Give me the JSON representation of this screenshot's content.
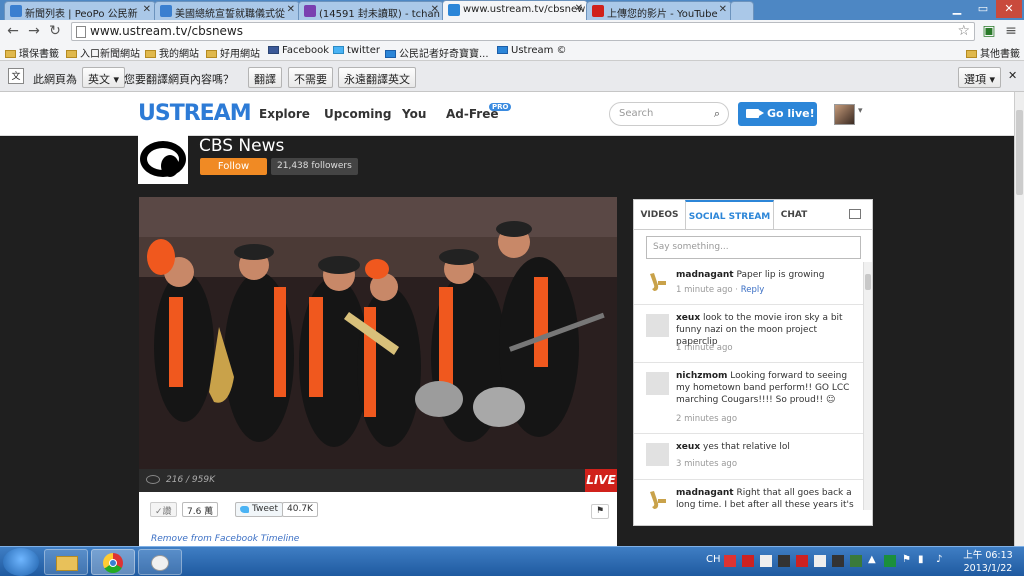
{
  "browser": {
    "tabs": [
      {
        "title": "新聞列表 | PeoPo 公民新",
        "icon_color": "#3a7fd0"
      },
      {
        "title": "美國總統宣誓就職儀式從",
        "icon_color": "#3a7fd0"
      },
      {
        "title": "(14591 封未讀取) - tchan",
        "icon_color": "#7a3fb0"
      },
      {
        "title": "www.ustream.tv/cbsnew",
        "icon_color": "#2c86d8"
      },
      {
        "title": "上傳您的影片 - YouTube",
        "icon_color": "#d0211b"
      }
    ],
    "url": "www.ustream.tv/cbsnews",
    "bookmarks": [
      "環保書籤",
      "入口新聞網站",
      "我的網站",
      "好用網站",
      "Facebook",
      "twitter",
      "公民記者好奇寶寶...",
      "Ustream ©",
      "其他書籤"
    ],
    "translate": {
      "prefix": "此網頁為",
      "language": "英文",
      "question": "您要翻譯網頁內容嗎？",
      "translate_btn": "翻譯",
      "no_btn": "不需要",
      "always_btn": "永遠翻譯英文",
      "options_btn": "選項"
    }
  },
  "site": {
    "logo": "USTREAM",
    "nav": [
      "Explore",
      "Upcoming",
      "You",
      "Ad-Free"
    ],
    "pro_badge": "PRO",
    "search_placeholder": "Search",
    "go_live": "Go live!"
  },
  "channel": {
    "name": "CBS News",
    "follow": "Follow",
    "followers": "21,438 followers",
    "viewers": "216 / 959K",
    "live_badge": "LIVE",
    "like_label": "讚",
    "like_count": "7.6 萬",
    "tweet_label": "Tweet",
    "tweet_count": "40.7K",
    "remove_link": "Remove from Facebook Timeline"
  },
  "social": {
    "tabs": [
      "VIDEOS",
      "SOCIAL STREAM",
      "CHAT"
    ],
    "placeholder": "Say something...",
    "messages": [
      {
        "user": "madnagant",
        "text": "Paper lip is growing",
        "time": "1 minute ago",
        "reply": "Reply"
      },
      {
        "user": "xeux",
        "text": "look to the movie iron sky a bit funny nazi on the moon project paperclip",
        "time": "1 minute ago"
      },
      {
        "user": "nichzmom",
        "text": "Looking forward to seeing my hometown band perform!! GO LCC marching Cougars!!!! So proud!!",
        "time": "2 minutes ago"
      },
      {
        "user": "xeux",
        "text": "yes that relative lol",
        "time": "3 minutes ago"
      },
      {
        "user": "madnagant",
        "text": "Right that all goes back a long time. I bet after all these years it's"
      }
    ]
  },
  "taskbar": {
    "lang": "CH",
    "time": "上午 06:13",
    "date": "2013/1/22"
  }
}
